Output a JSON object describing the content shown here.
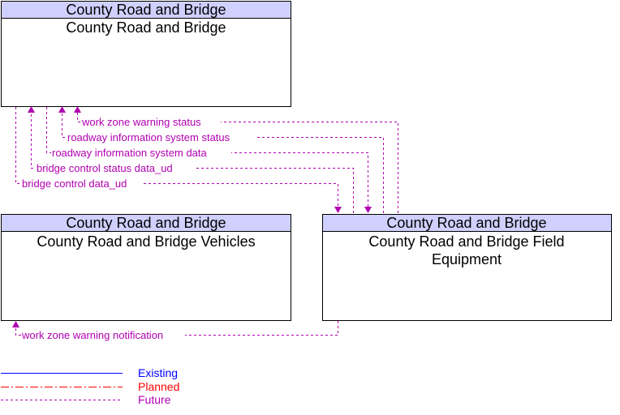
{
  "boxes": {
    "top": {
      "header": "County Road and Bridge",
      "name": "County Road and Bridge"
    },
    "vehicles": {
      "header": "County Road and Bridge",
      "name": "County Road and Bridge Vehicles"
    },
    "field": {
      "header": "County Road and Bridge",
      "name_line1": "County Road and Bridge Field",
      "name_line2": "Equipment"
    }
  },
  "flows": [
    "work zone warning status",
    "roadway information system status",
    "roadway information system data",
    "bridge control status data_ud",
    "bridge control data_ud",
    "work zone warning notification"
  ],
  "legend": {
    "existing": "Existing",
    "planned": "Planned",
    "future": "Future"
  },
  "colors": {
    "header_fill": "#d0d0ff",
    "future": "#b000b0",
    "existing": "#0000ff",
    "planned": "#ff0000"
  }
}
